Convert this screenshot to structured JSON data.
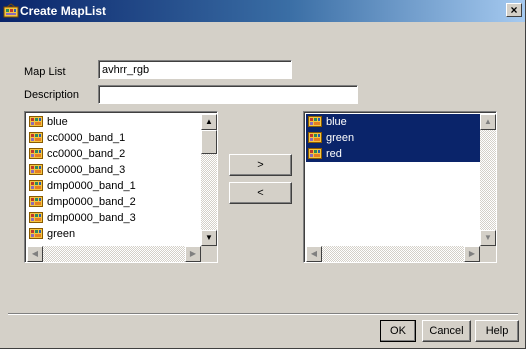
{
  "window": {
    "title": "Create MapList",
    "close_glyph": "×"
  },
  "form": {
    "maplist_label": "Map List",
    "maplist_value": "avhrr_rgb",
    "description_label": "Description",
    "description_value": ""
  },
  "source_list": {
    "items": [
      "blue",
      "cc0000_band_1",
      "cc0000_band_2",
      "cc0000_band_3",
      "dmp0000_band_1",
      "dmp0000_band_2",
      "dmp0000_band_3",
      "green"
    ]
  },
  "target_list": {
    "items": [
      "blue",
      "green",
      "red"
    ],
    "selected": [
      0,
      1,
      2
    ]
  },
  "transfer": {
    "add_label": ">",
    "remove_label": "<"
  },
  "footer": {
    "ok_label": "OK",
    "cancel_label": "Cancel",
    "help_label": "Help"
  },
  "icons": {
    "app": "maplist-app-icon",
    "map": "raster-map-icon",
    "scroll_up": "▲",
    "scroll_down": "▼",
    "scroll_left": "◀",
    "scroll_right": "▶"
  },
  "colors": {
    "title_start": "#0a246a",
    "title_end": "#a6caf0",
    "selection": "#0a246a",
    "face": "#d4d0c8"
  }
}
